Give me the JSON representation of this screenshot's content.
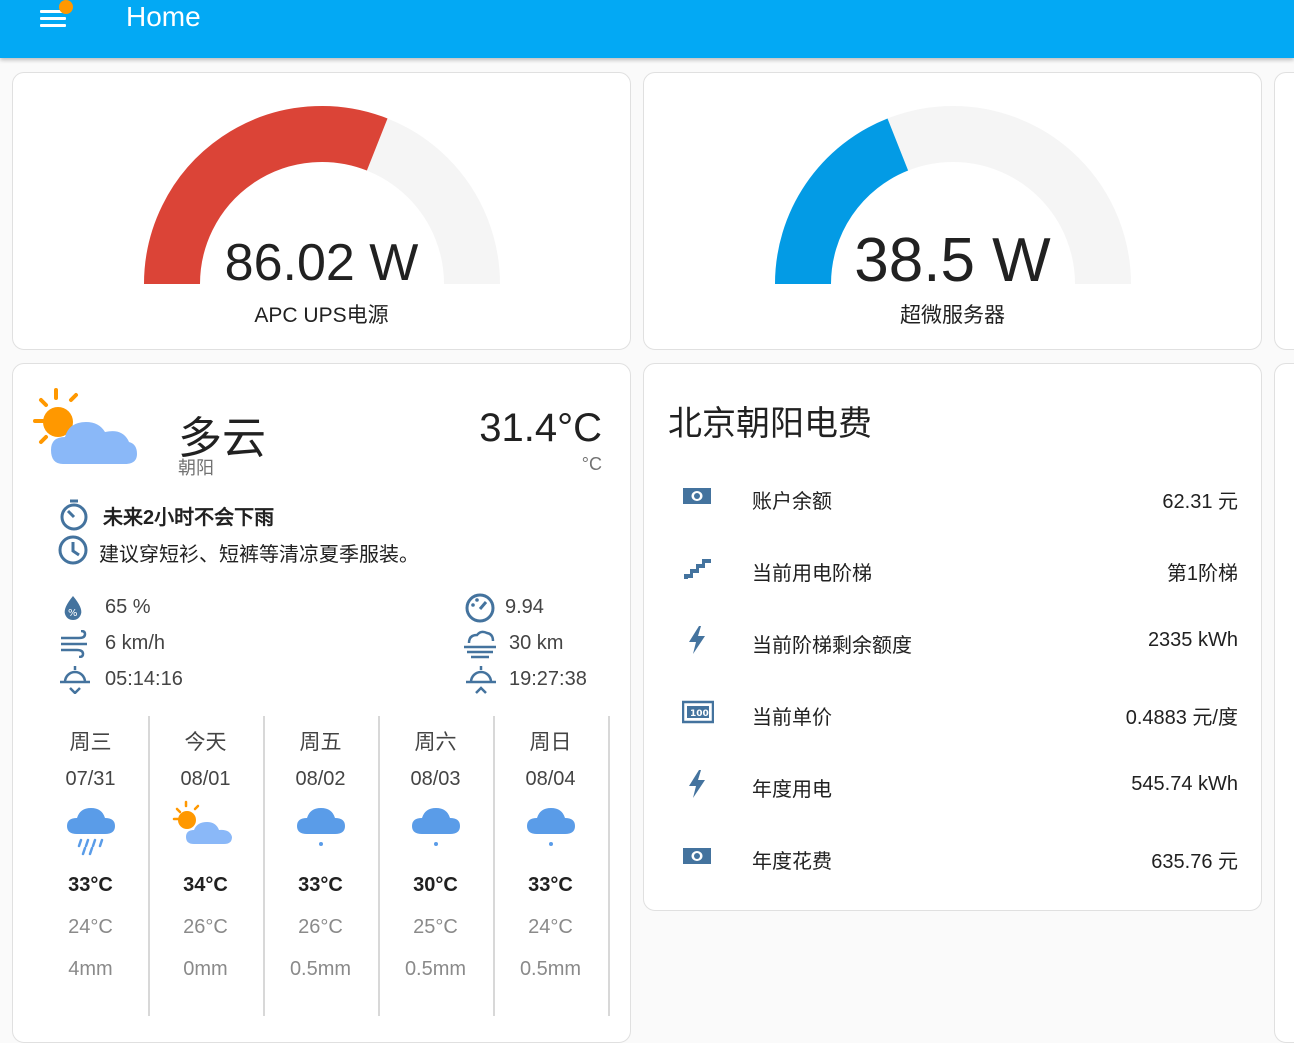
{
  "toolbar": {
    "title": "Home"
  },
  "colors": {
    "toolbar": "#03a9f4",
    "gauge_ups": "#db4437",
    "gauge_server": "#039be5",
    "gauge_bg": "#f5f5f5",
    "icon_blue": "#44739e",
    "sun": "#ff9800",
    "cloud": "#8ab8f8"
  },
  "gauges": [
    {
      "value": "86.02 W",
      "label": "APC UPS电源",
      "fraction": 0.62
    },
    {
      "value": "38.5 W",
      "label": "超微服务器",
      "fraction": 0.38
    }
  ],
  "weather": {
    "condition": "多云",
    "location": "朝阳",
    "temperature": "31.4°C",
    "temp_unit": "°C",
    "alert_title": "未来2小时不会下雨",
    "alert_text": "建议穿短衫、短裤等清凉夏季服装。",
    "humidity": "65 %",
    "wind": "6 km/h",
    "sunrise": "05:14:16",
    "pressure": "9.94",
    "visibility": "30 km",
    "sunset": "19:27:38",
    "forecast": [
      {
        "day": "周三",
        "date": "07/31",
        "icon": "rain-icon",
        "high": "33°C",
        "low": "24°C",
        "precip": "4mm"
      },
      {
        "day": "今天",
        "date": "08/01",
        "icon": "partly-cloudy-icon",
        "high": "34°C",
        "low": "26°C",
        "precip": "0mm"
      },
      {
        "day": "周五",
        "date": "08/02",
        "icon": "light-rain-icon",
        "high": "33°C",
        "low": "26°C",
        "precip": "0.5mm"
      },
      {
        "day": "周六",
        "date": "08/03",
        "icon": "light-rain-icon",
        "high": "30°C",
        "low": "25°C",
        "precip": "0.5mm"
      },
      {
        "day": "周日",
        "date": "08/04",
        "icon": "light-rain-icon",
        "high": "33°C",
        "low": "24°C",
        "precip": "0.5mm"
      }
    ]
  },
  "electricity": {
    "title": "北京朝阳电费",
    "rows": [
      {
        "icon": "cash-icon",
        "name": "账户余额",
        "value": "62.31 元"
      },
      {
        "icon": "stairs-icon",
        "name": "当前用电阶梯",
        "value": "第1阶梯"
      },
      {
        "icon": "flash-icon",
        "name": "当前阶梯剩余额度",
        "value": "2335 kWh"
      },
      {
        "icon": "cash-100-icon",
        "name": "当前单价",
        "value": "0.4883 元/度"
      },
      {
        "icon": "flash-icon",
        "name": "年度用电",
        "value": "545.74 kWh"
      },
      {
        "icon": "cash-icon",
        "name": "年度花费",
        "value": "635.76 元"
      }
    ]
  }
}
